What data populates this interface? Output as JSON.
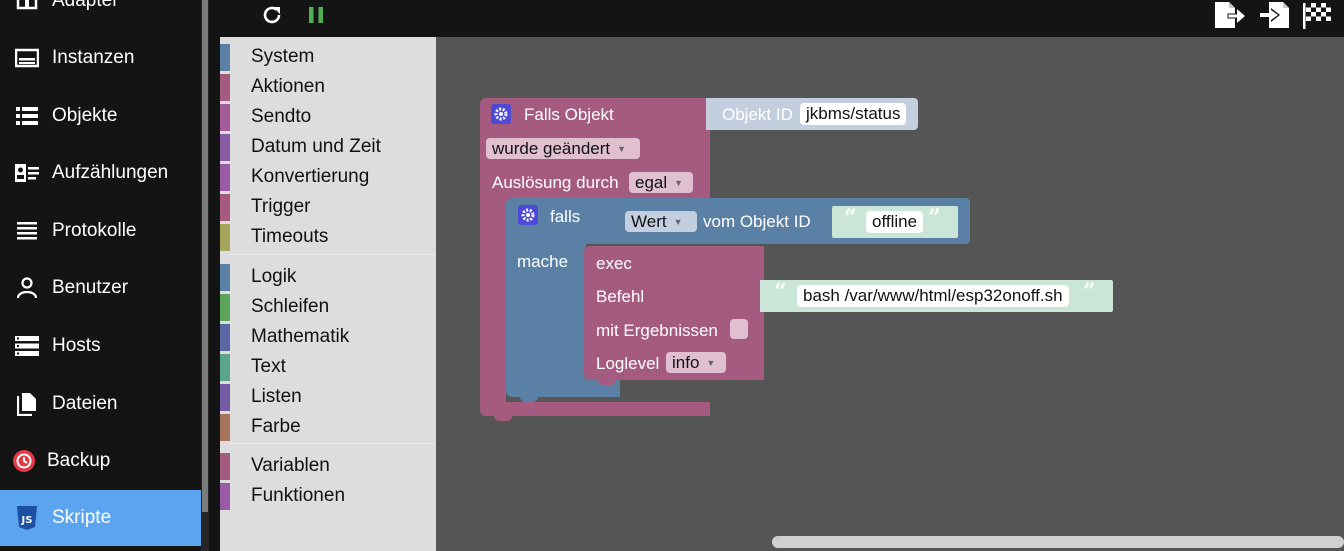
{
  "nav": {
    "items": [
      {
        "label": "Adapter",
        "icon": "adapter-icon"
      },
      {
        "label": "Instanzen",
        "icon": "instances-icon"
      },
      {
        "label": "Objekte",
        "icon": "objects-list-icon"
      },
      {
        "label": "Aufzählungen",
        "icon": "enums-icon"
      },
      {
        "label": "Protokolle",
        "icon": "log-lines-icon"
      },
      {
        "label": "Benutzer",
        "icon": "user-icon"
      },
      {
        "label": "Hosts",
        "icon": "hosts-icon"
      },
      {
        "label": "Dateien",
        "icon": "files-icon"
      },
      {
        "label": "Backup",
        "icon": "backup-icon"
      },
      {
        "label": "Skripte",
        "icon": "js-icon",
        "active": true
      }
    ],
    "active_color": "#5ba4f0"
  },
  "toolbar": {
    "icons": [
      "reload-icon",
      "pause-icon",
      "export-icon",
      "import-icon",
      "checkered-flag-icon"
    ],
    "pause_color": "#4caf50"
  },
  "toolbox": {
    "groups": [
      [
        {
          "label": "System",
          "color": "#5b80a5"
        },
        {
          "label": "Aktionen",
          "color": "#a55b80"
        },
        {
          "label": "Sendto",
          "color": "#a55b9a"
        },
        {
          "label": "Datum und Zeit",
          "color": "#8a5ba5"
        },
        {
          "label": "Konvertierung",
          "color": "#9a5ba5"
        },
        {
          "label": "Trigger",
          "color": "#a55b80"
        },
        {
          "label": "Timeouts",
          "color": "#a5a55b"
        }
      ],
      [
        {
          "label": "Logik",
          "color": "#5b80a5"
        },
        {
          "label": "Schleifen",
          "color": "#5ba55b"
        },
        {
          "label": "Mathematik",
          "color": "#5b67a5"
        },
        {
          "label": "Text",
          "color": "#5ba58c"
        },
        {
          "label": "Listen",
          "color": "#745ba5"
        },
        {
          "label": "Farbe",
          "color": "#a5745b"
        }
      ],
      [
        {
          "label": "Variablen",
          "color": "#a55b80"
        },
        {
          "label": "Funktionen",
          "color": "#995ba5"
        }
      ]
    ]
  },
  "workspace": {
    "trigger_block": {
      "title": "Falls Objekt",
      "object_id_label": "Objekt ID",
      "object_id_value": "jkbms/status",
      "condition": "wurde geändert",
      "trigger_label": "Auslösung durch",
      "trigger_value": "egal",
      "color": "#a55b80"
    },
    "if_block": {
      "if_label": "falls",
      "do_label": "mache",
      "value_dropdown": "Wert",
      "value_suffix": "vom Objekt ID",
      "compare_value": "offline",
      "color": "#5b80a5"
    },
    "exec_block": {
      "title": "exec",
      "command_label": "Befehl",
      "command_value": "bash /var/www/html/esp32onoff.sh",
      "results_label": "mit Ergebnissen",
      "loglevel_label": "Loglevel",
      "loglevel_value": "info",
      "color": "#a55b80"
    },
    "text_color": "#c9e6d6",
    "object_color": "#c3cfdf"
  }
}
